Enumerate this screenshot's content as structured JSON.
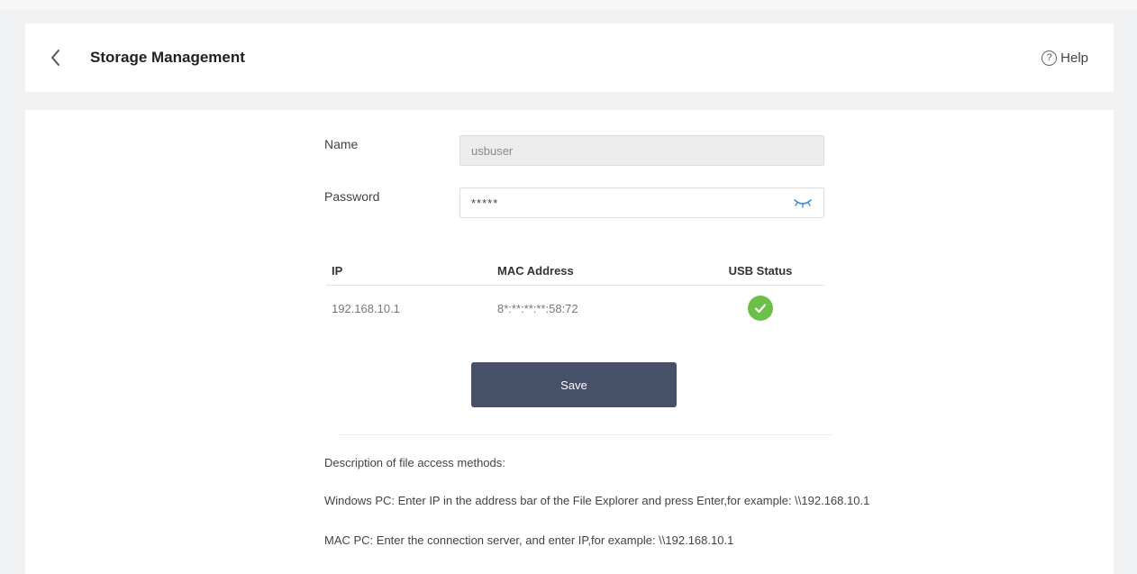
{
  "header": {
    "title": "Storage Management",
    "help_label": "Help"
  },
  "form": {
    "name_label": "Name",
    "name_value": "usbuser",
    "password_label": "Password",
    "password_value": "*****"
  },
  "table": {
    "headers": {
      "ip": "IP",
      "mac": "MAC Address",
      "usb_status": "USB Status"
    },
    "rows": [
      {
        "ip": "192.168.10.1",
        "mac": "8*:**:**:**:58:72",
        "usb_status": "connected"
      }
    ]
  },
  "save_label": "Save",
  "description": {
    "title": "Description of file access methods:",
    "windows": "Windows PC: Enter IP in the address bar of the File Explorer and press Enter,for example: \\\\192.168.10.1",
    "mac": "MAC PC: Enter the connection server, and enter IP,for example: \\\\192.168.10.1"
  },
  "colors": {
    "save_button": "#465169",
    "status_ok": "#6cc04a",
    "eye_icon": "#3b8fd8"
  },
  "icons": {
    "back": "chevron-left-icon",
    "help": "question-circle-icon",
    "password_toggle": "eye-closed-icon",
    "usb_status": "check-circle-icon"
  }
}
